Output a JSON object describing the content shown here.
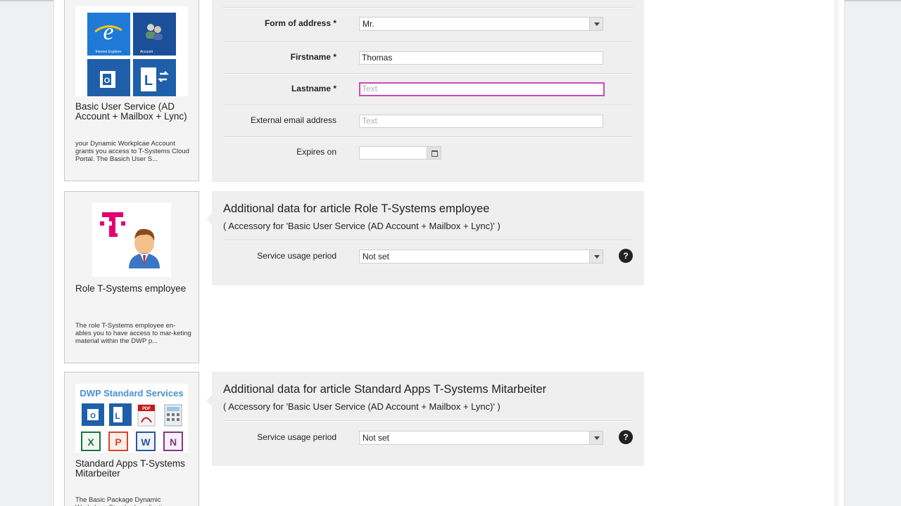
{
  "cards": [
    {
      "title": "Basic User Service (AD Account + Mailbox + Lync)",
      "description": "your Dynamic Workplcae Account grants you access to T-Systems Cloud Portal. The Basich User S...",
      "tiles": {
        "ie": "Internet Explorer",
        "account": "Account"
      }
    },
    {
      "title": "Role T-Systems employee",
      "description": "The role T-Systems employee en-ables you to have access to mar-keting material within the DWP p..."
    },
    {
      "title": "Standard Apps T-Systems Mitarbeiter",
      "description": "The Basic Package Dynamic Workplace Standard applications...",
      "logo_text": "DWP Standard Services"
    }
  ],
  "form": {
    "form_of_address": {
      "label": "Form of address *",
      "value": "Mr."
    },
    "firstname": {
      "label": "Firstname *",
      "value": "Thomas"
    },
    "lastname": {
      "label": "Lastname *",
      "placeholder": "Text"
    },
    "external_email": {
      "label": "External email address",
      "placeholder": "Text"
    },
    "expires_on": {
      "label": "Expires on",
      "value": ""
    }
  },
  "panels": [
    {
      "title": "Additional data for article Role T-Systems employee",
      "subtitle": "( Accessory for 'Basic User Service (AD Account + Mailbox + Lync)' )",
      "field_label": "Service usage period",
      "field_value": "Not set",
      "help": "?"
    },
    {
      "title": "Additional data for article Standard Apps T-Systems Mitarbeiter",
      "subtitle": "( Accessory for 'Basic User Service (AD Account + Mailbox + Lync)' )",
      "field_label": "Service usage period",
      "field_value": "Not set",
      "help": "?"
    }
  ],
  "colors": {
    "focus_border": "#c64bbd",
    "telekom_magenta": "#e20074",
    "tile_blue": "#1f5faa"
  }
}
